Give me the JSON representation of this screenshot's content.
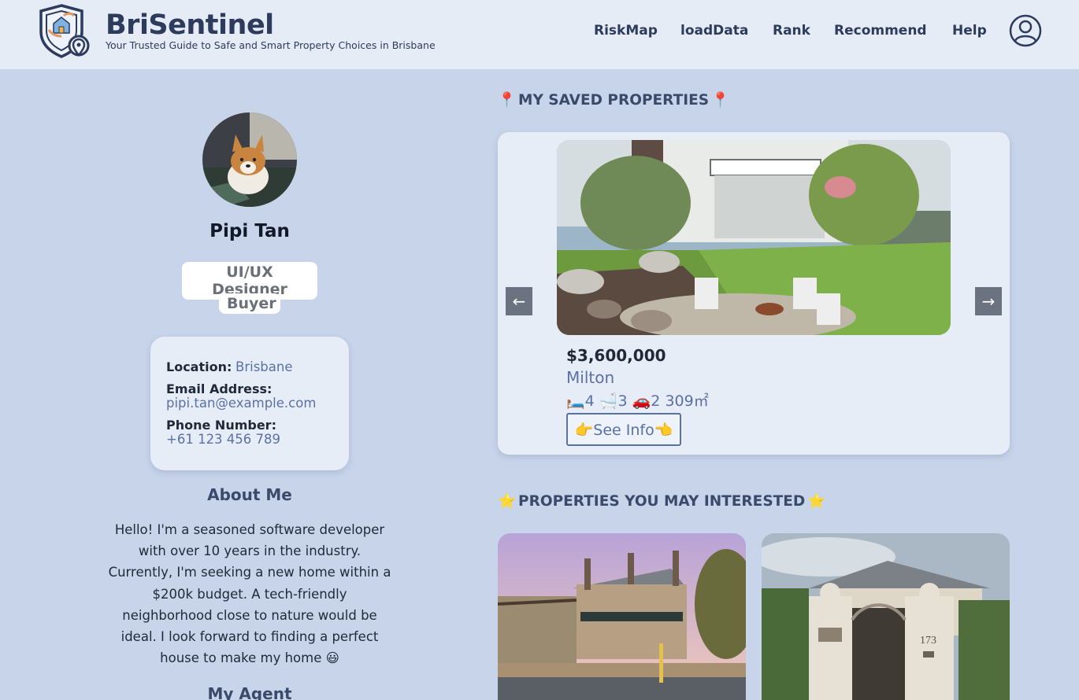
{
  "header": {
    "brand_title": "BriSentinel",
    "brand_subtitle": "Your Trusted Guide to Safe and Smart Property Choices in Brisbane",
    "nav": [
      "RiskMap",
      "loadData",
      "Rank",
      "Recommend",
      "Help"
    ]
  },
  "profile": {
    "name": "Pipi Tan",
    "roles": [
      "UI/UX Designer",
      "Buyer"
    ],
    "location_label": "Location:",
    "location": "Brisbane",
    "email_label": "Email Address:",
    "email": "pipi.tan@example.com",
    "phone_label": "Phone Number:",
    "phone": "+61 123 456 789",
    "about_heading": "About Me",
    "about_lines": [
      "Hello! I'm a seasoned software developer",
      "with over 10 years in the industry.",
      "Currently, I'm seeking a new home within a",
      "$200k budget. A tech-friendly",
      "neighborhood close to nature would be",
      "ideal. I look forward to finding a perfect",
      "house to make my home 😃"
    ],
    "agent_heading": "My Agent"
  },
  "saved": {
    "heading": "MY SAVED PROPERTIES",
    "heading_emoji": "📍",
    "prev_label": "←",
    "next_label": "→",
    "price": "$3,600,000",
    "suburb": "Milton",
    "beds": "4",
    "baths": "3",
    "cars": "2",
    "area": "309㎡",
    "bed_emoji": "🛏️",
    "bath_emoji": "🛁",
    "car_emoji": "🚗",
    "see_info_label": "👉See Info👈"
  },
  "interested": {
    "heading": "PROPERTIES YOU MAY INTERESTED",
    "heading_emoji": "⭐",
    "house_number": "173"
  },
  "colors": {
    "background": "#c7d4ea",
    "header": "#e6ecf6",
    "card": "#e7edf7",
    "accent": "#5a70a6",
    "heading": "#2d3b5c"
  }
}
